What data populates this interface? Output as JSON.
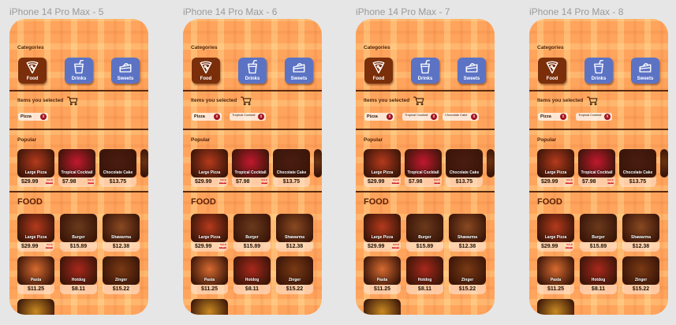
{
  "frames": [
    {
      "title": "iPhone 14 Pro Max - 5",
      "active_category": 0,
      "chips": [
        {
          "label": "Pizza"
        }
      ]
    },
    {
      "title": "iPhone 14 Pro Max - 6",
      "active_category": 0,
      "chips": [
        {
          "label": "Pizza"
        },
        {
          "label": "Tropical Cocktail"
        }
      ]
    },
    {
      "title": "iPhone 14 Pro Max - 7",
      "active_category": 0,
      "chips": [
        {
          "label": "Pizza"
        },
        {
          "label": "Tropical Cocktail"
        },
        {
          "label": "Chocolate Cake"
        }
      ]
    },
    {
      "title": "iPhone 14 Pro Max - 8",
      "active_category": 0,
      "chips": [
        {
          "label": "Pizza"
        },
        {
          "label": "Tropical Cocktail"
        }
      ]
    }
  ],
  "labels": {
    "categories": "Categories",
    "items_selected": "Items you selected",
    "popular": "Popular",
    "food": "FOOD",
    "remove_symbol": "x"
  },
  "categories": [
    {
      "label": "Food",
      "icon": "pizza-slice-icon"
    },
    {
      "label": "Drinks",
      "icon": "drink-cup-icon"
    },
    {
      "label": "Sweets",
      "icon": "cake-slice-icon"
    }
  ],
  "popular": [
    {
      "name": "Large Pizza",
      "price": "$29.99",
      "sale": [
        "SALE",
        "$39.99"
      ],
      "color": "#b53a1c"
    },
    {
      "name": "Tropical Cocktail",
      "price": "$7.98",
      "sale": [
        "SALE",
        "$9.99"
      ],
      "color": "#c2182e"
    },
    {
      "name": "Chocolate Cake",
      "price": "$13.75",
      "sale": null,
      "color": "#4a1c12"
    }
  ],
  "food": [
    {
      "name": "Large Pizza",
      "price": "$29.99",
      "sale": [
        "SALE",
        "$39.99"
      ],
      "color": "#b53a1c"
    },
    {
      "name": "Burger",
      "price": "$15.89",
      "sale": null,
      "color": "#6b3a1c"
    },
    {
      "name": "Shawarma",
      "price": "$12.38",
      "sale": null,
      "color": "#8a4a22"
    },
    {
      "name": "Pasta",
      "price": "$11.25",
      "sale": null,
      "color": "#d66a30"
    },
    {
      "name": "Hotdog",
      "price": "$8.11",
      "sale": null,
      "color": "#a8281c"
    },
    {
      "name": "Zinger",
      "price": "$15.22",
      "sale": null,
      "color": "#7a3a14"
    }
  ],
  "colors": {
    "background": "#ffa45c",
    "divider": "#5a2a10",
    "category_active": "#7a2e0a",
    "category_inactive": "#5c73c4",
    "remove_button": "#a3121e",
    "sale_text": "#d0182a"
  }
}
